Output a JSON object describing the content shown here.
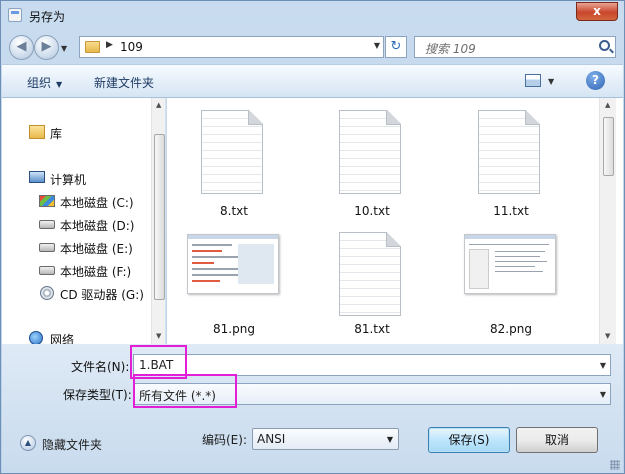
{
  "window": {
    "title": "另存为",
    "close_glyph": "x"
  },
  "address": {
    "path": "109",
    "refresh_glyph": "↻",
    "search_placeholder": "搜索 109"
  },
  "toolbar": {
    "organize": "组织",
    "new_folder": "新建文件夹",
    "help_glyph": "?"
  },
  "nav": {
    "items": [
      {
        "label": "库",
        "icon": "library-icon"
      },
      {
        "label": "计算机",
        "icon": "computer-icon"
      },
      {
        "label": "本地磁盘 (C:)",
        "icon": "system-drive-icon"
      },
      {
        "label": "本地磁盘 (D:)",
        "icon": "drive-icon"
      },
      {
        "label": "本地磁盘 (E:)",
        "icon": "drive-icon"
      },
      {
        "label": "本地磁盘 (F:)",
        "icon": "drive-icon"
      },
      {
        "label": "CD 驱动器 (G:)",
        "icon": "cd-drive-icon"
      },
      {
        "label": "网络",
        "icon": "network-icon"
      }
    ]
  },
  "files": [
    {
      "name": "8.txt",
      "type": "txt"
    },
    {
      "name": "10.txt",
      "type": "txt"
    },
    {
      "name": "11.txt",
      "type": "txt"
    },
    {
      "name": "81.png",
      "type": "png"
    },
    {
      "name": "81.txt",
      "type": "txt"
    },
    {
      "name": "82.png",
      "type": "png"
    }
  ],
  "form": {
    "filename_label": "文件名(N):",
    "filename_value": "1.BAT",
    "filetype_label": "保存类型(T):",
    "filetype_value": "所有文件 (*.*)",
    "highlight_color": "#e21ed6"
  },
  "footer": {
    "hide_folders": "隐藏文件夹",
    "encoding_label": "编码(E):",
    "encoding_value": "ANSI",
    "save": "保存(S)",
    "cancel": "取消"
  }
}
